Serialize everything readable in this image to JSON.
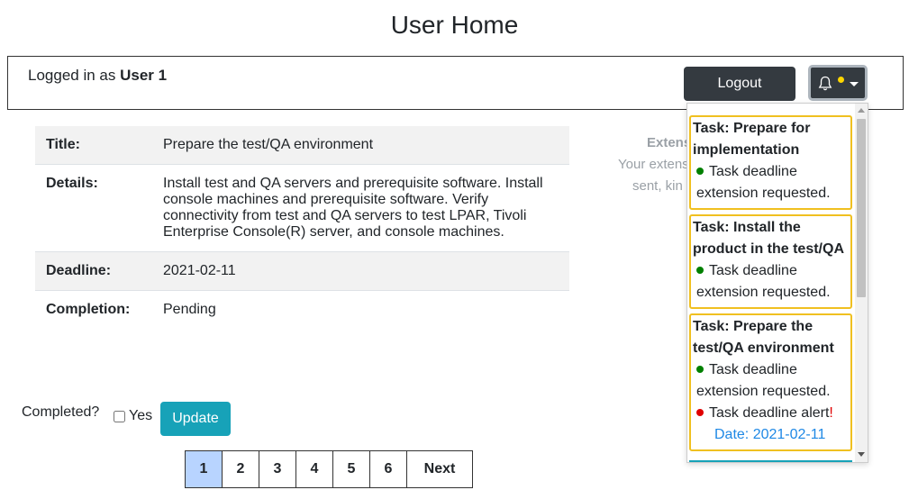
{
  "page": {
    "title": "User Home"
  },
  "header": {
    "logged_prefix": "Logged in as ",
    "user_name": "User 1",
    "logout_label": "Logout"
  },
  "task": {
    "rows": [
      {
        "label": "Title:",
        "value": "Prepare the test/QA environment"
      },
      {
        "label": "Details:",
        "value": "Install test and QA servers and prerequisite software. Install console machines and prerequisite software. Verify connectivity from test and QA servers to test LPAR, Tivoli Enterprise Console(R) server, and console machines."
      },
      {
        "label": "Deadline:",
        "value": "2021-02-11"
      },
      {
        "label": "Completion:",
        "value": "Pending"
      }
    ]
  },
  "extension": {
    "title": "Extens",
    "line1": "Your extens",
    "line2": "sent, kin"
  },
  "form": {
    "completed_label": "Completed?",
    "yes_label": "Yes",
    "update_label": "Update"
  },
  "pagination": {
    "pages": [
      "1",
      "2",
      "3",
      "4",
      "5",
      "6"
    ],
    "next_label": "Next",
    "active_page": "1"
  },
  "notifications": [
    {
      "title": "Task: Prepare for implementation",
      "messages": [
        {
          "status": "green",
          "text": "Task deadline extension requested."
        }
      ]
    },
    {
      "title": "Task: Install the product in the test/QA",
      "messages": [
        {
          "status": "green",
          "text": "Task deadline extension requested."
        }
      ]
    },
    {
      "title": "Task: Prepare the test/QA environment",
      "messages": [
        {
          "status": "green",
          "text": "Task deadline extension requested."
        },
        {
          "status": "red",
          "text": "Task deadline alert",
          "suffix": "!"
        }
      ],
      "date": "Date: 2021-02-11"
    }
  ],
  "colors": {
    "dark_button": "#343a40",
    "info_button": "#17a2b8",
    "notification_border": "#f0c020",
    "status_green": "#008000",
    "status_red": "#e00000",
    "active_page": "#b8d4ff",
    "bell_dot": "#ffd600"
  },
  "icons": {
    "notification_bell": "bell-icon",
    "dropdown": "caret-down-icon"
  }
}
